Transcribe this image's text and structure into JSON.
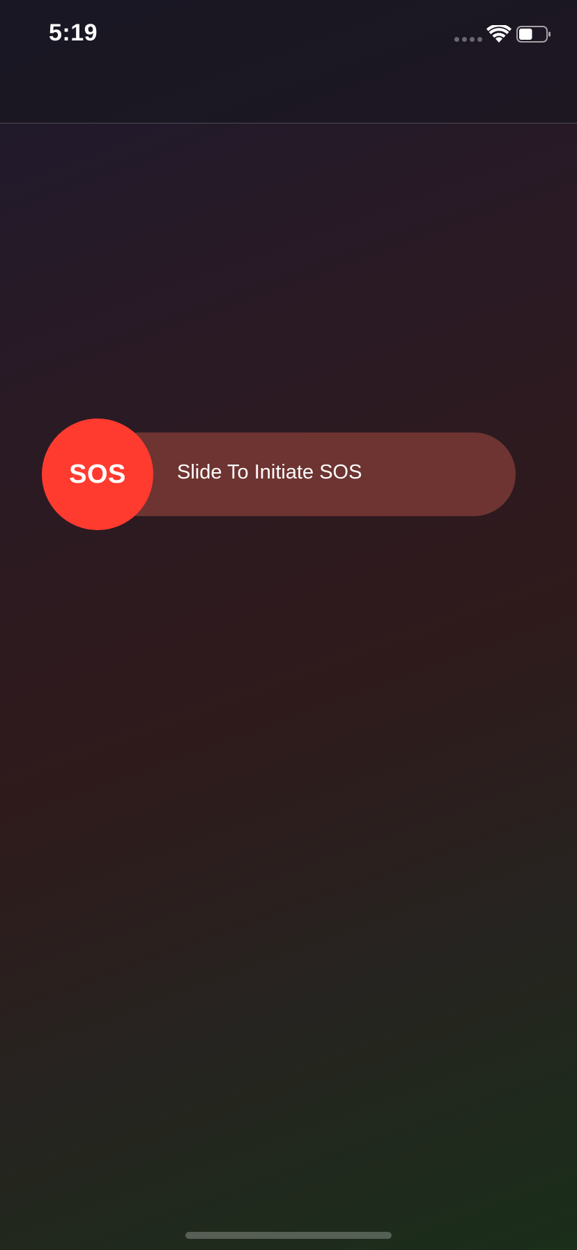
{
  "status_bar": {
    "time": "5:19",
    "signal_icon": "cellular-signal-icon",
    "wifi_icon": "wifi-icon",
    "battery_icon": "battery-icon",
    "battery_level": 0.5
  },
  "sos_slider": {
    "knob_label": "SOS",
    "track_label": "Slide To Initiate SOS",
    "knob_color": "#ff3b30",
    "track_color": "#6e3431"
  },
  "home_indicator": {
    "icon": "home-indicator"
  }
}
